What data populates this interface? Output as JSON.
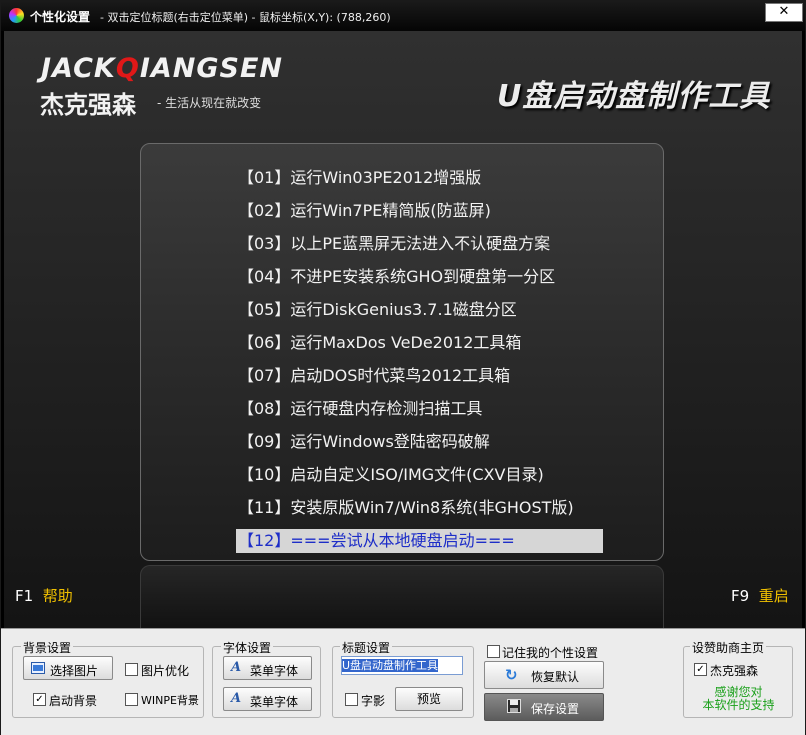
{
  "window": {
    "app_name": "个性化设置",
    "title_rest": " - 双击定位标题(右击定位菜单) - 鼠标坐标(X,Y): (788,260)",
    "close_label": "✕"
  },
  "brand": {
    "logo_en_1": "JACK",
    "logo_en_q": "Q",
    "logo_en_2": "IANGSEN",
    "logo_cn": "杰克强森",
    "slogan": "- 生活从现在就改变",
    "app_title": "U盘启动盘制作工具"
  },
  "menu": {
    "items": [
      "【01】运行Win03PE2012增强版",
      "【02】运行Win7PE精简版(防蓝屏)",
      "【03】以上PE蓝黑屏无法进入不认硬盘方案",
      "【04】不进PE安装系统GHO到硬盘第一分区",
      "【05】运行DiskGenius3.7.1磁盘分区",
      "【06】运行MaxDos VeDe2012工具箱",
      "【07】启动DOS时代菜鸟2012工具箱",
      "【08】运行硬盘内存检测扫描工具",
      "【09】运行Windows登陆密码破解",
      "【10】启动自定义ISO/IMG文件(CXV目录)",
      "【11】安装原版Win7/Win8系统(非GHOST版)",
      "【12】===尝试从本地硬盘启动==="
    ],
    "selected_index": 11
  },
  "hotkeys": {
    "f1_key": "F1",
    "f1_action": "帮助",
    "f9_key": "F9",
    "f9_action": "重启"
  },
  "settings": {
    "bg": {
      "title": "背景设置",
      "select_image": "选择图片",
      "image_optimize": "图片优化",
      "image_optimize_checked": false,
      "enable_bg": "启动背景",
      "enable_bg_checked": true,
      "winpe_bg": "WINPE背景",
      "winpe_bg_checked": false
    },
    "font": {
      "title": "字体设置",
      "menu_font_1": "菜单字体",
      "menu_font_2": "菜单字体"
    },
    "heading": {
      "title": "标题设置",
      "input_value": "U盘启动盘制作工具",
      "shadow": "字影",
      "shadow_checked": false,
      "preview": "预览"
    },
    "actions": {
      "remember": "记住我的个性设置",
      "remember_checked": false,
      "restore": "恢复默认",
      "save": "保存设置"
    },
    "sponsor": {
      "title": "设赞助商主页",
      "name": "杰克强森",
      "name_checked": true,
      "thanks_1": "感谢您对",
      "thanks_2": "本软件的支持"
    }
  },
  "colors": {
    "accent_q": "#e01818",
    "hotkey_action": "#f0c000",
    "selected_text": "#1e2ec8",
    "thanks_text": "#1aa01a"
  }
}
